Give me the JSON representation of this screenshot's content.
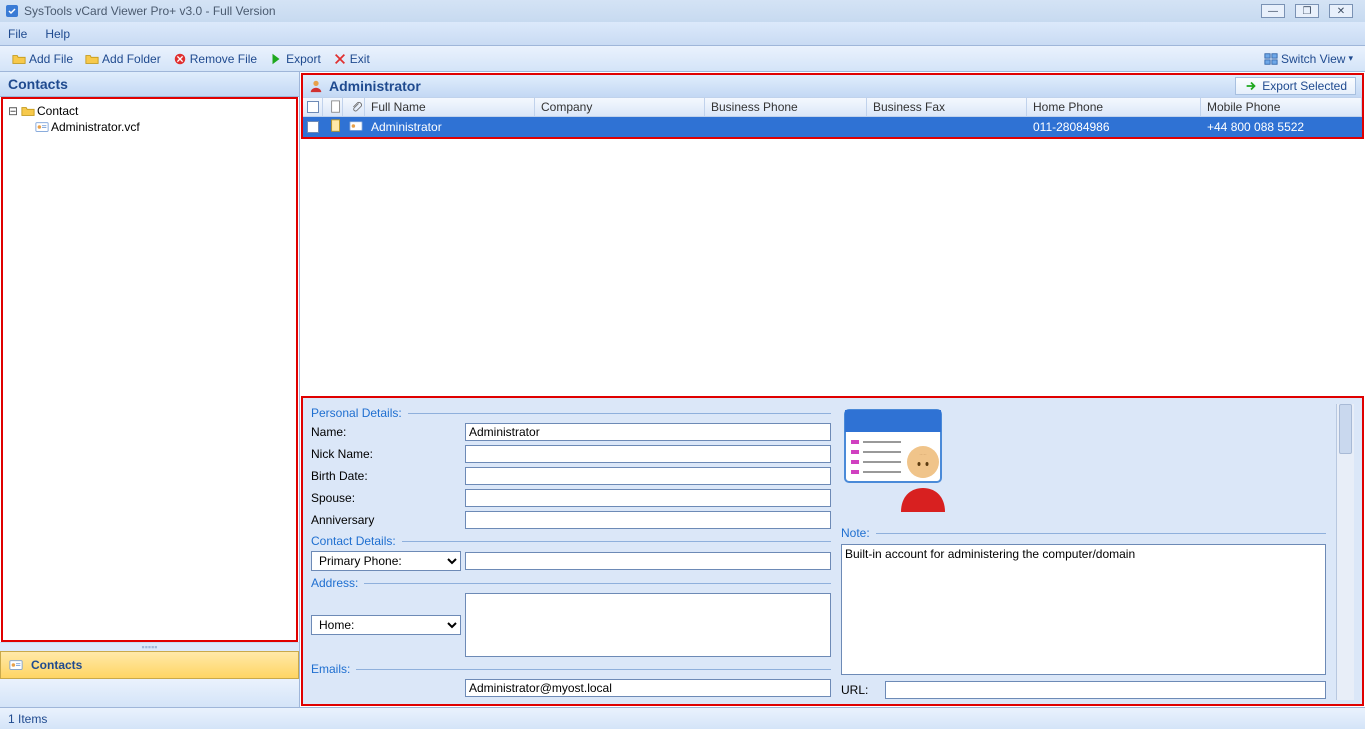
{
  "window": {
    "title": "SysTools vCard Viewer Pro+ v3.0 - Full Version"
  },
  "menu": {
    "file": "File",
    "help": "Help"
  },
  "toolbar": {
    "add_file": "Add File",
    "add_folder": "Add Folder",
    "remove_file": "Remove File",
    "export": "Export",
    "exit": "Exit",
    "switch_view": "Switch View"
  },
  "sidebar": {
    "header": "Contacts",
    "tree": {
      "root": "Contact",
      "file": "Administrator.vcf"
    },
    "nav_item": "Contacts"
  },
  "grid": {
    "title": "Administrator",
    "export_selected": "Export Selected",
    "headers": {
      "full_name": "Full Name",
      "company": "Company",
      "business_phone": "Business Phone",
      "business_fax": "Business Fax",
      "home_phone": "Home Phone",
      "mobile_phone": "Mobile Phone"
    },
    "row": {
      "full_name": "Administrator",
      "company": "",
      "business_phone": "",
      "business_fax": "",
      "home_phone": "011-28084986",
      "mobile_phone": "+44 800 088 5522"
    }
  },
  "details": {
    "personal_label": "Personal Details:",
    "name_label": "Name:",
    "name_value": "Administrator",
    "nick_label": "Nick Name:",
    "nick_value": "",
    "birth_label": "Birth Date:",
    "birth_value": "",
    "spouse_label": "Spouse:",
    "spouse_value": "",
    "anniv_label": "Anniversary",
    "anniv_value": "",
    "contact_label": "Contact Details:",
    "primary_phone_select": "Primary Phone:",
    "primary_phone_value": "",
    "address_label": "Address:",
    "address_select": "Home:",
    "address_value": "",
    "emails_label": "Emails:",
    "emails_value": "Administrator@myost.local",
    "note_label": "Note:",
    "note_value": "Built-in account for administering the computer/domain",
    "url_label": "URL:",
    "url_value": ""
  },
  "status": {
    "items": "1 Items"
  }
}
